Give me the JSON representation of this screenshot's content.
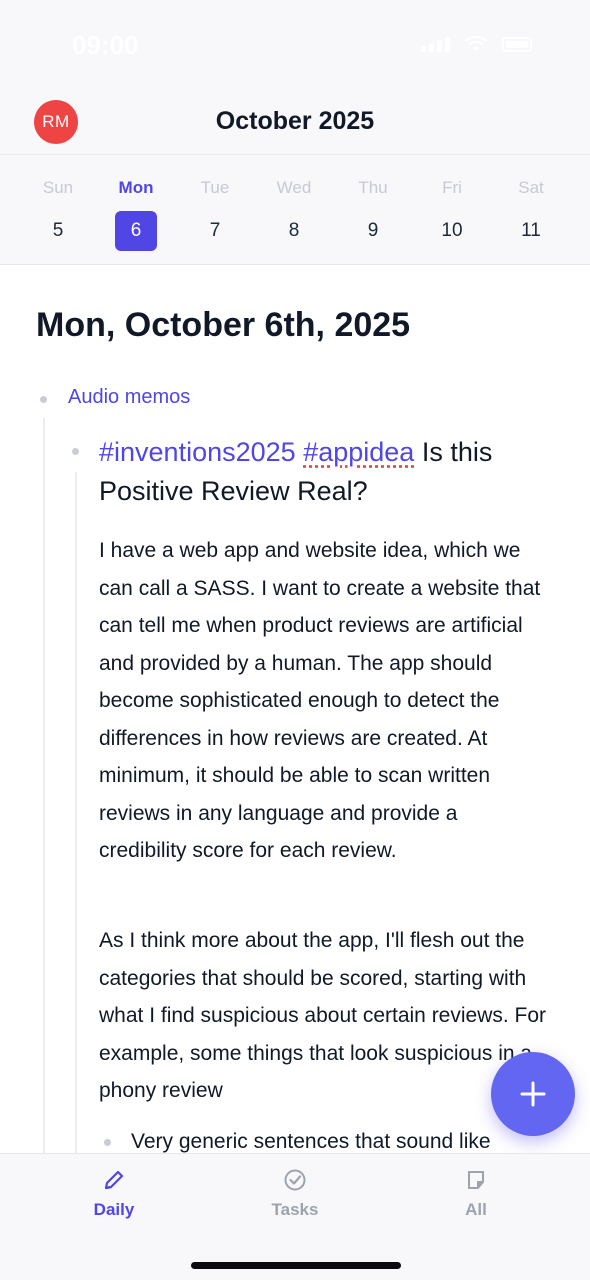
{
  "status_bar": {
    "time": "09:00"
  },
  "header": {
    "avatar_initials": "RM",
    "month_title": "October 2025"
  },
  "week": [
    {
      "name": "Sun",
      "num": "5"
    },
    {
      "name": "Mon",
      "num": "6",
      "active": true
    },
    {
      "name": "Tue",
      "num": "7"
    },
    {
      "name": "Wed",
      "num": "8"
    },
    {
      "name": "Thu",
      "num": "9"
    },
    {
      "name": "Fri",
      "num": "10"
    },
    {
      "name": "Sat",
      "num": "11"
    }
  ],
  "content": {
    "date_heading": "Mon, October 6th, 2025",
    "section_label": "Audio memos",
    "memo": {
      "tag1": "#inventions2025",
      "tag2": "#appidea",
      "title": "Is this Positive Review Real?",
      "paragraph1": "I have a web app and website idea, which we can call a SASS. I want to create a website that can tell me when product reviews are artificial and provided by a human. The app should become sophisticated enough to detect the differences in how reviews are created. At minimum, it should be able to scan written reviews in any language and provide a credibility score for each review.",
      "paragraph2": "As I think more about the app, I'll flesh out the categories that should be scored, starting with what I find suspicious about certain reviews. For example, some things that look suspicious in a phony review",
      "sub_bullet": "Very generic sentences that sound like"
    }
  },
  "fab": {
    "icon": "plus-icon"
  },
  "tabbar": {
    "tabs": [
      {
        "label": "Daily",
        "icon": "pencil-icon",
        "active": true
      },
      {
        "label": "Tasks",
        "icon": "check-circle-icon"
      },
      {
        "label": "All",
        "icon": "note-icon"
      }
    ]
  },
  "colors": {
    "accent": "#4f46e5",
    "fab": "#6366f1",
    "avatar": "#ef4444"
  }
}
